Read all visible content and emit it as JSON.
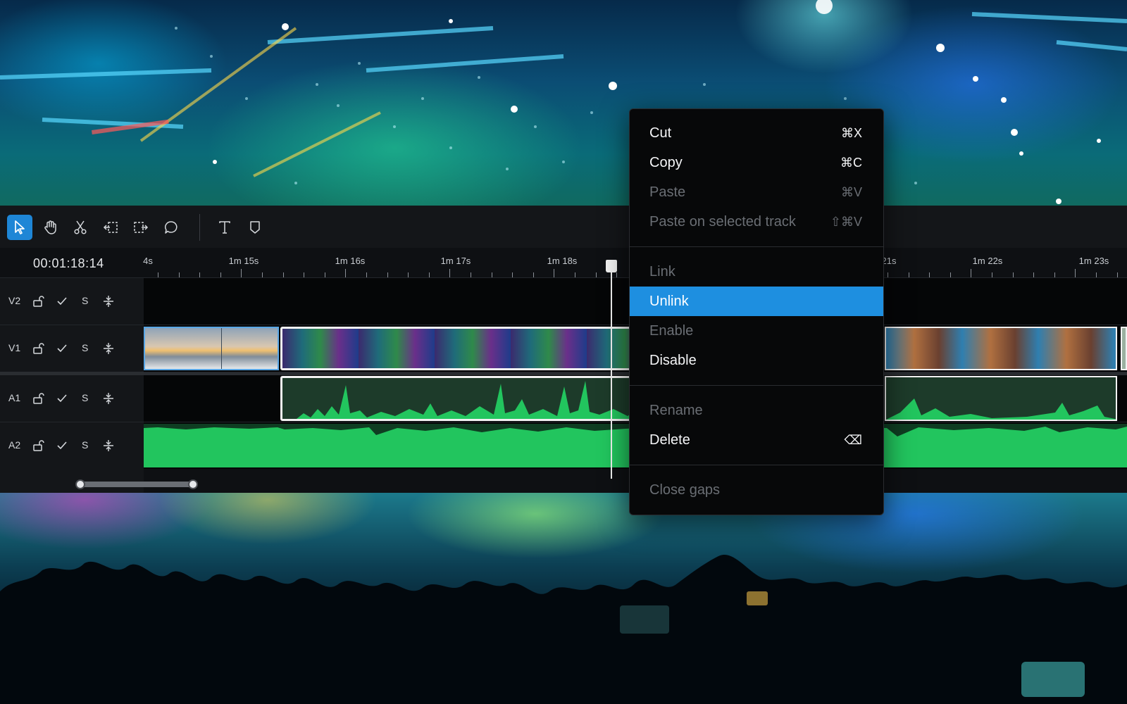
{
  "toolbar": {
    "tools": [
      {
        "icon": "pointer-icon",
        "active": true
      },
      {
        "icon": "hand-icon",
        "active": false
      },
      {
        "icon": "scissors-icon",
        "active": false
      },
      {
        "icon": "ripple-trim-left-icon",
        "active": false
      },
      {
        "icon": "ripple-trim-right-icon",
        "active": false
      },
      {
        "icon": "comment-icon",
        "active": false
      },
      {
        "icon": "text-icon",
        "active": false
      },
      {
        "icon": "marker-icon",
        "active": false
      }
    ]
  },
  "timeline": {
    "timecode": "00:01:18:14",
    "ruler_labels": [
      "4s",
      "1m 15s",
      "1m 16s",
      "1m 17s",
      "1m 18s",
      "21s",
      "1m 22s",
      "1m 23s"
    ],
    "tracks": [
      {
        "name": "V2",
        "solo_label": "S"
      },
      {
        "name": "V1",
        "solo_label": "S"
      },
      {
        "name": "A1",
        "solo_label": "S"
      },
      {
        "name": "A2",
        "solo_label": "S"
      }
    ]
  },
  "context_menu": {
    "groups": [
      [
        {
          "label": "Cut",
          "shortcut": "⌘X",
          "enabled": true
        },
        {
          "label": "Copy",
          "shortcut": "⌘C",
          "enabled": true
        },
        {
          "label": "Paste",
          "shortcut": "⌘V",
          "enabled": false
        },
        {
          "label": "Paste on selected track",
          "shortcut": "⇧⌘V",
          "enabled": false
        }
      ],
      [
        {
          "label": "Link",
          "shortcut": "",
          "enabled": false
        },
        {
          "label": "Unlink",
          "shortcut": "",
          "enabled": true,
          "highlighted": true
        },
        {
          "label": "Enable",
          "shortcut": "",
          "enabled": false
        },
        {
          "label": "Disable",
          "shortcut": "",
          "enabled": true
        }
      ],
      [
        {
          "label": "Rename",
          "shortcut": "",
          "enabled": false
        },
        {
          "label": "Delete",
          "shortcut": "⌫",
          "enabled": true
        }
      ],
      [
        {
          "label": "Close gaps",
          "shortcut": "",
          "enabled": false
        }
      ]
    ]
  },
  "colors": {
    "accent": "#1e8fe0",
    "audio_green": "#22c55e",
    "audio_dark": "#1d3b2a"
  }
}
